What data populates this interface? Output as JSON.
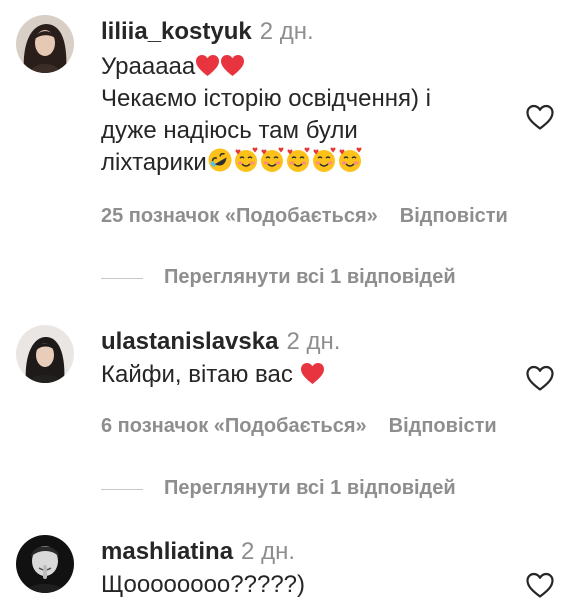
{
  "comments": [
    {
      "username": "liliia_kostyuk",
      "time": "2 дн.",
      "lines": [
        "Урааааа",
        "Чекаємо історію освідчення) і",
        "дуже надіюсь там були",
        "ліхтарики"
      ],
      "likes": "25 позначок «Подобається»",
      "reply": "Відповісти",
      "view_replies": "Переглянути всі 1 відповідей",
      "emoji_after_line1": [
        "red-heart-icon",
        "red-heart-icon"
      ],
      "emoji_after_line4": [
        "rolling-laughing-face-icon",
        "smiling-face-with-hearts-icon",
        "smiling-face-with-hearts-icon",
        "smiling-face-with-hearts-icon",
        "smiling-face-with-hearts-icon",
        "smiling-face-with-hearts-icon"
      ]
    },
    {
      "username": "ulastanislavska",
      "time": "2 дн.",
      "lines": [
        "Кайфи, вітаю вас"
      ],
      "likes": "6 позначок «Подобається»",
      "reply": "Відповісти",
      "view_replies": "Переглянути всі 1 відповідей",
      "emoji_after_line1": [
        "red-heart-icon"
      ]
    },
    {
      "username": "mashliatina",
      "time": "2 дн.",
      "lines": [
        "Щоооооооо?????)"
      ]
    }
  ],
  "colors": {
    "text": "#262626",
    "secondary": "#8e8e8e",
    "heart": "#ed4956",
    "divider": "#c7c7c7"
  }
}
